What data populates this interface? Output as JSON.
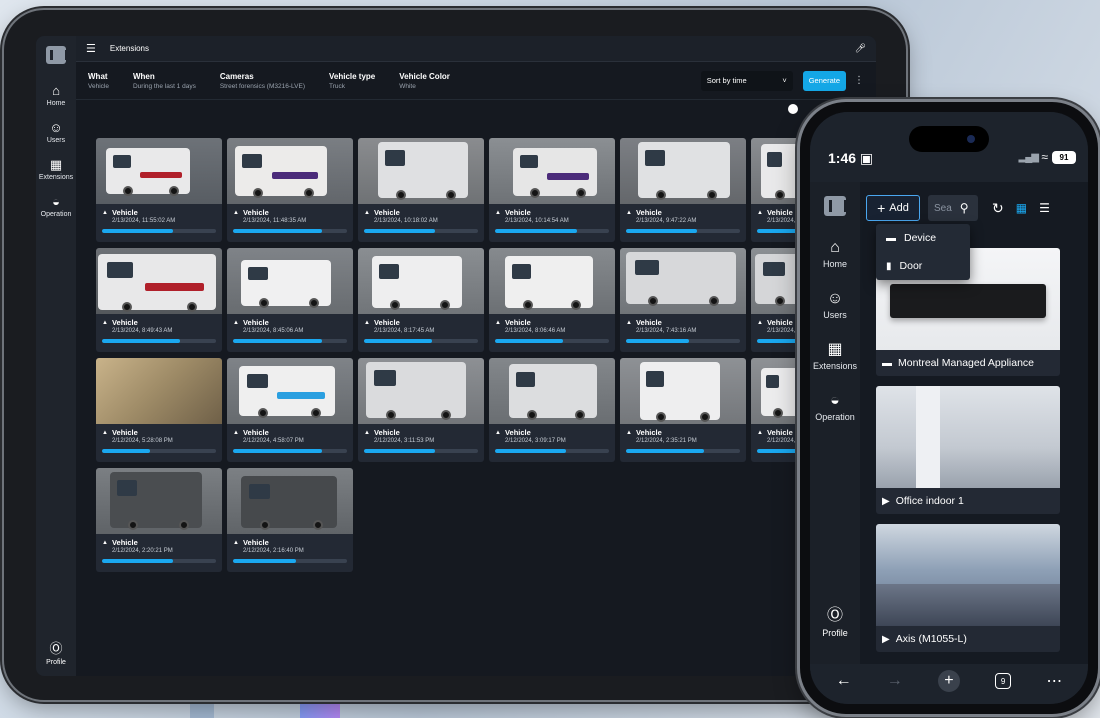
{
  "tablet": {
    "topbar": {
      "title": "Extensions"
    },
    "rail": {
      "items": [
        {
          "label": "Home",
          "icon": "home-icon"
        },
        {
          "label": "Users",
          "icon": "users-icon"
        },
        {
          "label": "Extensions",
          "icon": "extensions-icon"
        },
        {
          "label": "Operation",
          "icon": "operation-icon"
        }
      ],
      "profile": "Profile"
    },
    "filters": [
      {
        "label": "What",
        "value": "Vehicle"
      },
      {
        "label": "When",
        "value": "During the last 1 days"
      },
      {
        "label": "Cameras",
        "value": "Street forensics (M3216-LVE)"
      },
      {
        "label": "Vehicle type",
        "value": "Truck"
      },
      {
        "label": "Vehicle Color",
        "value": "White"
      }
    ],
    "sort": {
      "label": "Sort by time"
    },
    "generate_label": "Generate",
    "results": [
      {
        "title": "Vehicle",
        "time": "2/13/2024, 11:55:02 AM",
        "score": 0.62,
        "scene": "fedex-van"
      },
      {
        "title": "Vehicle",
        "time": "2/13/2024, 11:48:35 AM",
        "score": 0.78,
        "scene": "fedex-van2"
      },
      {
        "title": "Vehicle",
        "time": "2/13/2024, 10:18:02 AM",
        "score": 0.62,
        "scene": "box-truck"
      },
      {
        "title": "Vehicle",
        "time": "2/13/2024, 10:14:54 AM",
        "score": 0.72,
        "scene": "fedex-truck"
      },
      {
        "title": "Vehicle",
        "time": "2/13/2024, 9:47:22 AM",
        "score": 0.62,
        "scene": "box-truck2"
      },
      {
        "title": "Vehicle",
        "time": "2/13/2024, 9:",
        "score": 0.5,
        "scene": "van-partial"
      },
      {
        "title": "Vehicle",
        "time": "2/13/2024, 8:49:43 AM",
        "score": 0.68,
        "scene": "fedex-close"
      },
      {
        "title": "Vehicle",
        "time": "2/13/2024, 8:45:06 AM",
        "score": 0.78,
        "scene": "white-van"
      },
      {
        "title": "Vehicle",
        "time": "2/13/2024, 8:17:45 AM",
        "score": 0.6,
        "scene": "white-van2"
      },
      {
        "title": "Vehicle",
        "time": "2/13/2024, 8:06:46 AM",
        "score": 0.6,
        "scene": "white-van3"
      },
      {
        "title": "Vehicle",
        "time": "2/13/2024, 7:43:16 AM",
        "score": 0.55,
        "scene": "trailer"
      },
      {
        "title": "Vehicle",
        "time": "2/13/2024, ",
        "score": 0.5,
        "scene": "trailer-partial"
      },
      {
        "title": "Vehicle",
        "time": "2/12/2024, 5:28:08 PM",
        "score": 0.42,
        "scene": "blur"
      },
      {
        "title": "Vehicle",
        "time": "2/12/2024, 4:58:07 PM",
        "score": 0.78,
        "scene": "peace-van"
      },
      {
        "title": "Vehicle",
        "time": "2/12/2024, 3:11:53 PM",
        "score": 0.62,
        "scene": "box-truck3"
      },
      {
        "title": "Vehicle",
        "time": "2/12/2024, 3:09:17 PM",
        "score": 0.62,
        "scene": "box-truck4"
      },
      {
        "title": "Vehicle",
        "time": "2/12/2024, 2:35:21 PM",
        "score": 0.68,
        "scene": "van-front"
      },
      {
        "title": "Vehicle",
        "time": "2/12/2024, ",
        "score": 0.5,
        "scene": "van-partial2"
      },
      {
        "title": "Vehicle",
        "time": "2/12/2024, 2:20:21 PM",
        "score": 0.62,
        "scene": "dark-truck"
      },
      {
        "title": "Vehicle",
        "time": "2/12/2024, 2:16:40 PM",
        "score": 0.55,
        "scene": "dark-truck2"
      }
    ]
  },
  "phone": {
    "status": {
      "time": "1:46",
      "battery": "91"
    },
    "rail": {
      "items": [
        {
          "label": "Home",
          "icon": "home-icon"
        },
        {
          "label": "Users",
          "icon": "users-icon"
        },
        {
          "label": "Extensions",
          "icon": "extensions-icon"
        },
        {
          "label": "Operation",
          "icon": "operation-icon"
        }
      ],
      "profile": "Profile"
    },
    "add_label": "Add",
    "search_placeholder": "Sea",
    "dropdown": [
      {
        "label": "Device",
        "icon": "device-icon"
      },
      {
        "label": "Door",
        "icon": "door-icon"
      }
    ],
    "devices": [
      {
        "label": "Montreal Managed Appliance",
        "icon": "appliance-icon",
        "scene": "appliance"
      },
      {
        "label": "Office indoor 1",
        "icon": "camera-icon",
        "scene": "office"
      },
      {
        "label": "Axis (M1055-L)",
        "icon": "camera-icon",
        "scene": "hall"
      }
    ],
    "bottom": {
      "tabs_count": "9"
    }
  },
  "colors": {
    "accent": "#14a7e6",
    "bg": "#151920",
    "card": "#232934"
  }
}
